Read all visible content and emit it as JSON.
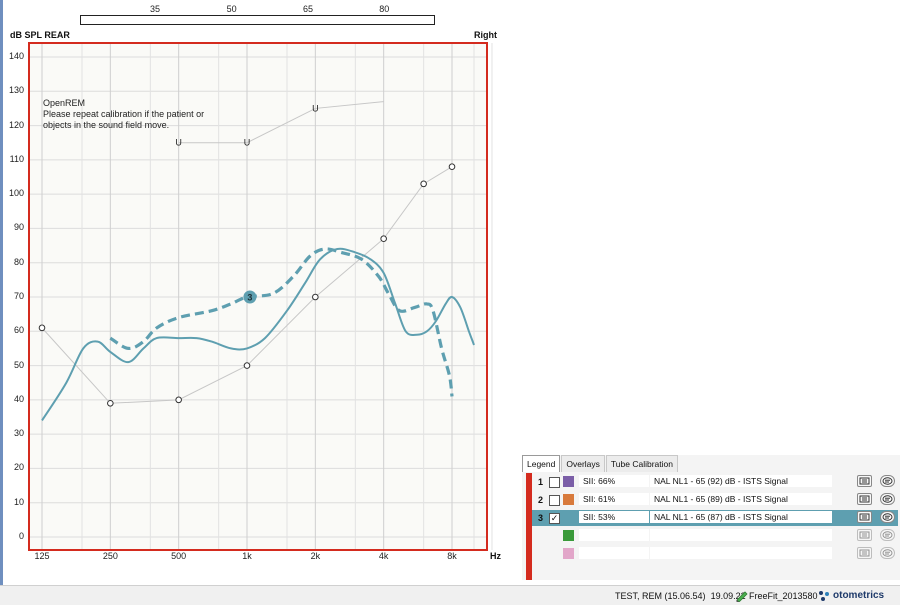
{
  "input_scale": {
    "ticks": [
      "35",
      "50",
      "65",
      "80"
    ]
  },
  "chart_header": {
    "title": "dB SPL REAR",
    "side": "Right",
    "x_unit": "Hz"
  },
  "note": {
    "lines": [
      "OpenREM",
      "Please repeat calibration if the patient or",
      "objects in the sound field move."
    ]
  },
  "chart_data": {
    "type": "line",
    "title": "dB SPL REAR",
    "xlabel": "Hz",
    "ylabel": "dB SPL REAR",
    "x_scale": "log",
    "x_ticks": [
      "125",
      "250",
      "500",
      "1k",
      "2k",
      "4k",
      "8k"
    ],
    "x_tick_values": [
      125,
      250,
      500,
      1000,
      2000,
      4000,
      8000
    ],
    "ylim": [
      0,
      140
    ],
    "y_ticks": [
      0,
      10,
      20,
      30,
      40,
      50,
      60,
      70,
      80,
      90,
      100,
      110,
      120,
      130,
      140
    ],
    "grid": true,
    "series": [
      {
        "name": "Thresholds",
        "style": "circles",
        "color": "#c7c7c7",
        "points": [
          [
            125,
            61
          ],
          [
            250,
            39
          ],
          [
            500,
            40
          ],
          [
            1000,
            50
          ],
          [
            2000,
            70
          ],
          [
            4000,
            87
          ],
          [
            6000,
            103
          ],
          [
            8000,
            108
          ]
        ]
      },
      {
        "name": "UCL",
        "style": "U",
        "color": "#c7c7c7",
        "points": [
          [
            500,
            115
          ],
          [
            1000,
            115
          ],
          [
            2000,
            125
          ],
          [
            4000,
            127
          ]
        ]
      },
      {
        "name": "Measured",
        "style": "solid",
        "color": "#5e9fb0",
        "points": [
          [
            125,
            34
          ],
          [
            160,
            45
          ],
          [
            190,
            55
          ],
          [
            220,
            57
          ],
          [
            250,
            54
          ],
          [
            300,
            51
          ],
          [
            350,
            55
          ],
          [
            400,
            58
          ],
          [
            500,
            58
          ],
          [
            600,
            58
          ],
          [
            700,
            57
          ],
          [
            850,
            55
          ],
          [
            1000,
            55
          ],
          [
            1200,
            58
          ],
          [
            1500,
            66
          ],
          [
            1800,
            74
          ],
          [
            2100,
            81
          ],
          [
            2500,
            84
          ],
          [
            3000,
            83
          ],
          [
            3500,
            81
          ],
          [
            4000,
            77
          ],
          [
            4500,
            68
          ],
          [
            5000,
            60
          ],
          [
            5600,
            59
          ],
          [
            6200,
            60
          ],
          [
            6800,
            63
          ],
          [
            7500,
            68
          ],
          [
            8000,
            70
          ],
          [
            8700,
            67
          ],
          [
            9500,
            60
          ],
          [
            10000,
            56
          ]
        ]
      },
      {
        "name": "Target 3",
        "style": "dashed",
        "color": "#5e9fb0",
        "marker_label": "3",
        "points": [
          [
            250,
            58
          ],
          [
            300,
            55
          ],
          [
            350,
            57
          ],
          [
            400,
            61
          ],
          [
            500,
            64
          ],
          [
            700,
            66
          ],
          [
            850,
            68
          ],
          [
            1000,
            70
          ],
          [
            1300,
            71
          ],
          [
            1600,
            76
          ],
          [
            1900,
            82
          ],
          [
            2200,
            84
          ],
          [
            2600,
            83
          ],
          [
            3200,
            81
          ],
          [
            3800,
            76
          ],
          [
            4200,
            71
          ],
          [
            4700,
            66
          ],
          [
            5500,
            67
          ],
          [
            6200,
            68
          ],
          [
            6600,
            66
          ],
          [
            7200,
            55
          ],
          [
            7800,
            47
          ],
          [
            8000,
            41
          ]
        ]
      }
    ]
  },
  "legend": {
    "tabs": [
      "Legend",
      "Overlays",
      "Tube Calibration"
    ],
    "active_tab": "Legend",
    "rows": [
      {
        "num": "1",
        "checked": false,
        "color": "#7b5ea7",
        "sii": "SII: 66%",
        "desc": "NAL NL1 - 65 (92) dB - ISTS Signal"
      },
      {
        "num": "2",
        "checked": false,
        "color": "#d87a3c",
        "sii": "SII: 61%",
        "desc": "NAL NL1 - 65 (89) dB - ISTS Signal"
      },
      {
        "num": "3",
        "checked": true,
        "color": "#5e9fb0",
        "sii": "SII: 53%",
        "desc": "NAL NL1 - 65 (87) dB - ISTS Signal"
      },
      {
        "num": "",
        "checked": null,
        "color": "#3a9a3a",
        "sii": "",
        "desc": ""
      },
      {
        "num": "",
        "checked": null,
        "color": "#e2a6c9",
        "sii": "",
        "desc": ""
      }
    ]
  },
  "status_bar": {
    "session": "TEST, REM (15.06.54)",
    "date": "19.09.22",
    "device": "FreeFit_2013580",
    "brand": "otometrics"
  },
  "colors": {
    "frame_red": "#d42b1e",
    "curve_teal": "#5e9fb0",
    "grid": "#dcdcdc",
    "plot_bg": "#fafaf7"
  }
}
